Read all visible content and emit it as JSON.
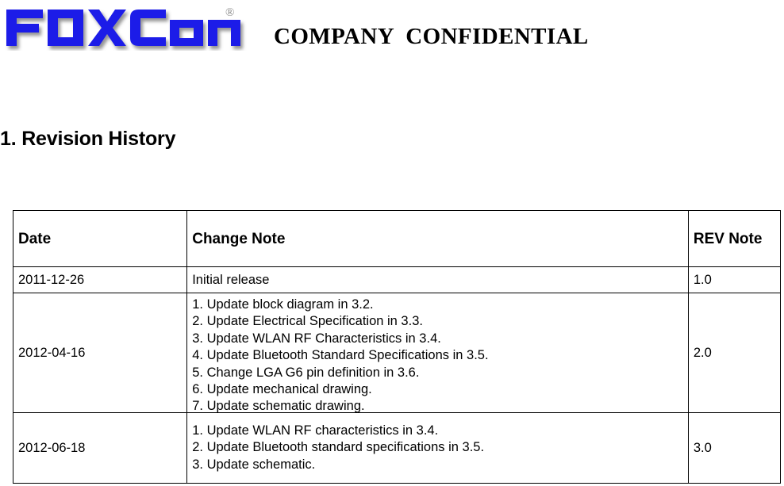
{
  "header": {
    "logo_text": "FOXCONN",
    "logo_trademark": "®",
    "logo_color": "#1A1AE8",
    "confidential_label": "COMPANY  CONFIDENTIAL"
  },
  "section": {
    "title": "1. Revision History"
  },
  "table": {
    "columns": [
      "Date",
      "Change Note",
      "REV Note"
    ],
    "rows": [
      {
        "date": "2011-12-26",
        "notes": [
          "Initial release"
        ],
        "rev": "1.0"
      },
      {
        "date": "2012-04-16",
        "notes": [
          "1. Update block diagram in 3.2.",
          "2. Update Electrical Specification in 3.3.",
          "3. Update WLAN RF Characteristics in 3.4.",
          "4. Update Bluetooth Standard Specifications in 3.5.",
          "5. Change LGA G6 pin definition in 3.6.",
          "6. Update mechanical drawing.",
          "7. Update schematic drawing."
        ],
        "rev": "2.0"
      },
      {
        "date": "2012-06-18",
        "notes": [
          "1. Update WLAN RF characteristics in 3.4.",
          "2. Update Bluetooth standard specifications in 3.5.",
          "3. Update schematic."
        ],
        "rev": "3.0"
      }
    ]
  }
}
